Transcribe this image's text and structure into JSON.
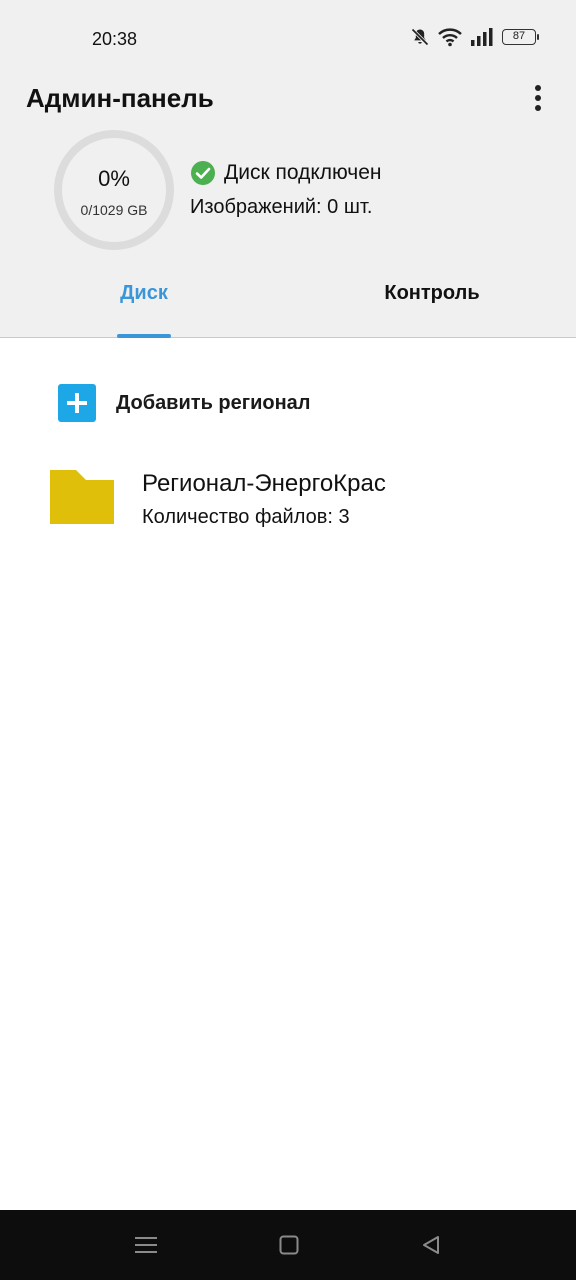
{
  "status_bar": {
    "time": "20:38",
    "battery_level": "87",
    "icons": [
      "mute-bell-icon",
      "wifi-icon",
      "signal-icon",
      "battery-icon"
    ]
  },
  "header": {
    "title": "Админ-панель",
    "menu_icon": "more-vert-icon"
  },
  "disk": {
    "percent": "0%",
    "usage": "0/1029 GB",
    "used_fraction": 0,
    "status": "Диск подключен",
    "images": "Изображений: 0 шт."
  },
  "tabs": [
    {
      "label": "Диск",
      "active": true
    },
    {
      "label": "Контроль",
      "active": false
    }
  ],
  "content": {
    "add_label": "Добавить регионал",
    "folders": [
      {
        "name": "Регионал-ЭнергоКрас",
        "count": "Количество файлов: 3"
      }
    ]
  },
  "nav_bar": {
    "icons": [
      "menu-icon",
      "home-icon",
      "back-icon"
    ]
  },
  "colors": {
    "accent": "#3a96d8",
    "add_button": "#1ea7e6",
    "folder": "#e0bf0b",
    "status_ok": "#4caf50"
  }
}
